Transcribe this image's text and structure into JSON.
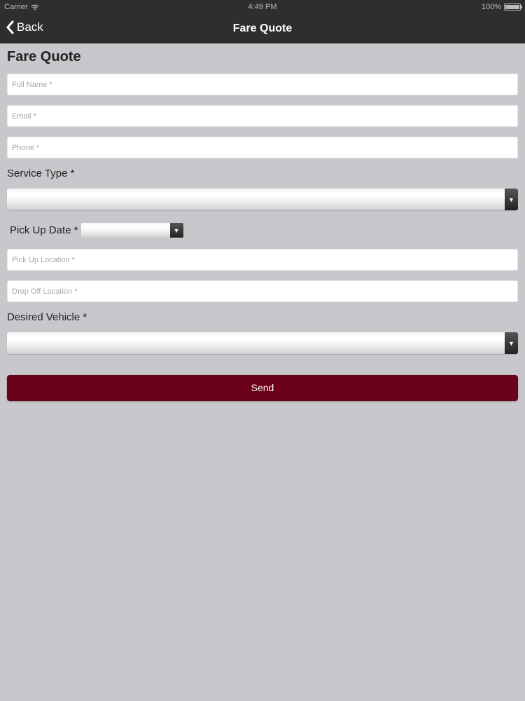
{
  "status_bar": {
    "carrier": "Carrier",
    "time": "4:49 PM",
    "battery": "100%"
  },
  "navbar": {
    "back_label": "Back",
    "title": "Fare Quote"
  },
  "form": {
    "title": "Fare Quote",
    "full_name_placeholder": "Full Name *",
    "email_placeholder": "Email *",
    "phone_placeholder": "Phone *",
    "service_type_label": "Service Type *",
    "service_type_value": "",
    "pickup_date_label": "Pick Up Date *",
    "pickup_date_value": "",
    "pickup_location_placeholder": "Pick Up Location *",
    "dropoff_location_placeholder": "Drop Off Location *",
    "desired_vehicle_label": "Desired Vehicle *",
    "desired_vehicle_value": "",
    "send_label": "Send"
  },
  "icons": {
    "wifi": "wifi-icon",
    "battery": "battery-icon",
    "back": "chevron-left-icon",
    "dropdown": "triangle-down-icon"
  },
  "colors": {
    "nav_background": "#2e2e2e",
    "page_background": "#c8c8cc",
    "send_button": "#6b0019"
  }
}
